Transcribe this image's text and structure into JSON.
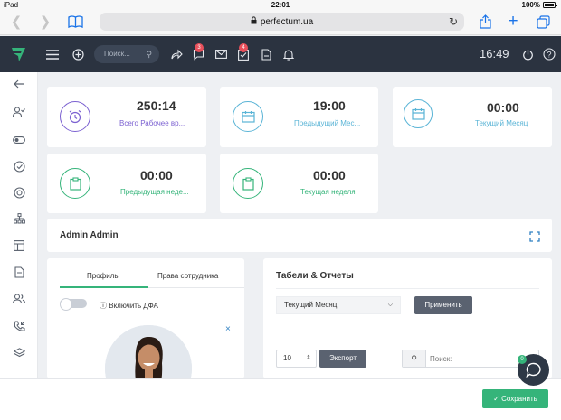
{
  "ios_status": {
    "device": "iPad",
    "time": "22:01",
    "battery": "100%"
  },
  "browser": {
    "url": "perfectum.ua"
  },
  "header": {
    "search_placeholder": "Поиск...",
    "chat_badge": "3",
    "tasks_badge": "4",
    "clock": "16:49"
  },
  "stats": [
    {
      "value": "250:14",
      "label": "Всего Рабочее вр...",
      "color": "#7b61d1"
    },
    {
      "value": "19:00",
      "label": "Предыдущий Мес...",
      "color": "#5ab4d6"
    },
    {
      "value": "00:00",
      "label": "Текущий Месяц",
      "color": "#5ab4d6"
    },
    {
      "value": "00:00",
      "label": "Предыдущая неде...",
      "color": "#35b47a"
    },
    {
      "value": "00:00",
      "label": "Текущая неделя",
      "color": "#35b47a"
    }
  ],
  "user": {
    "name": "Admin Admin"
  },
  "profile": {
    "tabs": [
      "Профиль",
      "Права сотрудника"
    ],
    "toggle_label": "Включить ДФА"
  },
  "reports": {
    "title": "Табели & Отчеты",
    "period": "Текущий Месяц",
    "apply_label": "Применить",
    "page_size": "10",
    "export_label": "Экспорт",
    "search_placeholder": "Поиск:"
  },
  "chat_widget_badge": "0",
  "footer": {
    "save_label": "Сохранить"
  },
  "colors": {
    "accent": "#35b47a",
    "header_bg": "#2b3340",
    "badge": "#e8505b"
  }
}
